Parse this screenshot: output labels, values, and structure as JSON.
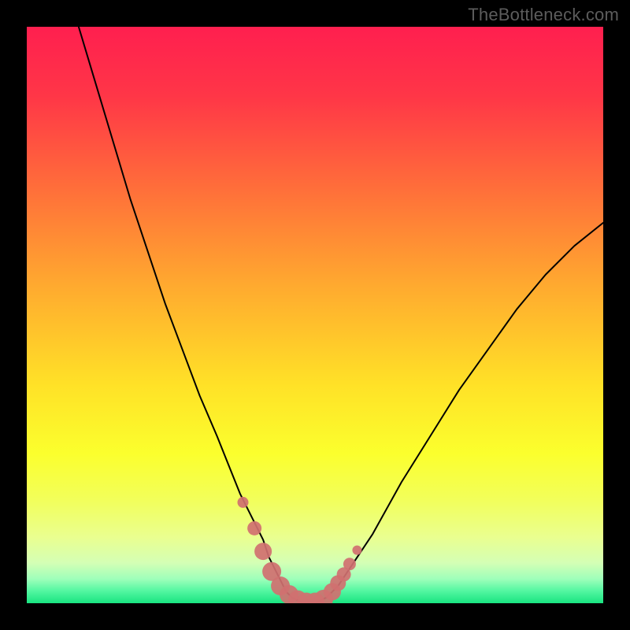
{
  "watermark": "TheBottleneck.com",
  "chart_data": {
    "type": "line",
    "title": "",
    "xlabel": "",
    "ylabel": "",
    "xlim": [
      0,
      100
    ],
    "ylim": [
      0,
      100
    ],
    "grid": false,
    "legend": false,
    "series": [
      {
        "name": "bottleneck-curve",
        "x": [
          9,
          12,
          15,
          18,
          21,
          24,
          27,
          30,
          33,
          35,
          37,
          39,
          41,
          42,
          43,
          44,
          45,
          46,
          48,
          50,
          52,
          54,
          56,
          60,
          65,
          70,
          75,
          80,
          85,
          90,
          95,
          100
        ],
        "y": [
          100,
          90,
          80,
          70,
          61,
          52,
          44,
          36,
          29,
          24,
          19,
          15,
          11,
          8,
          6,
          4,
          2,
          1,
          0,
          0,
          1,
          3,
          6,
          12,
          21,
          29,
          37,
          44,
          51,
          57,
          62,
          66
        ],
        "color": "#000000",
        "line_width": 2
      }
    ],
    "markers": {
      "name": "highlight-dots",
      "color": "#d07070",
      "points": [
        {
          "x": 37.5,
          "y": 17.5,
          "r": 7
        },
        {
          "x": 39.5,
          "y": 13.0,
          "r": 9
        },
        {
          "x": 41.0,
          "y": 9.0,
          "r": 11
        },
        {
          "x": 42.5,
          "y": 5.5,
          "r": 12
        },
        {
          "x": 44.0,
          "y": 3.0,
          "r": 12
        },
        {
          "x": 45.5,
          "y": 1.5,
          "r": 12
        },
        {
          "x": 47.0,
          "y": 0.6,
          "r": 12
        },
        {
          "x": 48.5,
          "y": 0.2,
          "r": 12
        },
        {
          "x": 50.0,
          "y": 0.2,
          "r": 12
        },
        {
          "x": 51.5,
          "y": 0.7,
          "r": 12
        },
        {
          "x": 53.0,
          "y": 2.0,
          "r": 11
        },
        {
          "x": 54.0,
          "y": 3.5,
          "r": 10
        },
        {
          "x": 55.0,
          "y": 5.0,
          "r": 9
        },
        {
          "x": 56.0,
          "y": 6.8,
          "r": 8
        },
        {
          "x": 57.3,
          "y": 9.2,
          "r": 6
        }
      ]
    },
    "background_gradient": {
      "type": "vertical",
      "stops": [
        {
          "offset": 0.0,
          "color": "#ff1f4f"
        },
        {
          "offset": 0.12,
          "color": "#ff3647"
        },
        {
          "offset": 0.28,
          "color": "#ff6e3a"
        },
        {
          "offset": 0.45,
          "color": "#ffaa2f"
        },
        {
          "offset": 0.62,
          "color": "#ffe127"
        },
        {
          "offset": 0.74,
          "color": "#fbff2d"
        },
        {
          "offset": 0.82,
          "color": "#f2ff5a"
        },
        {
          "offset": 0.885,
          "color": "#eaff8f"
        },
        {
          "offset": 0.93,
          "color": "#d4ffb5"
        },
        {
          "offset": 0.958,
          "color": "#9effba"
        },
        {
          "offset": 0.978,
          "color": "#55f7a2"
        },
        {
          "offset": 1.0,
          "color": "#19e481"
        }
      ]
    }
  }
}
